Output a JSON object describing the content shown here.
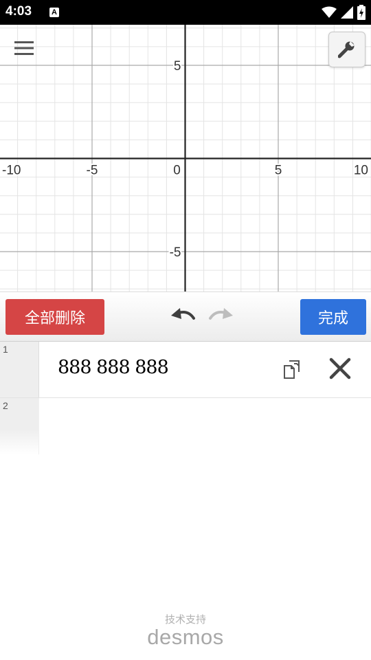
{
  "status_bar": {
    "time": "4:03",
    "notification_icon": "A"
  },
  "graph": {
    "x_range": [
      -10,
      10
    ],
    "y_range": [
      -7,
      7
    ],
    "grid": true,
    "x_tick_labels": [
      "-10",
      "-5",
      "0",
      "5",
      "10"
    ],
    "y_tick_labels": [
      "5",
      "-5"
    ]
  },
  "graph_controls": {
    "menu_icon": "hamburger-menu-icon",
    "settings_icon": "wrench-icon"
  },
  "toolbar": {
    "delete_all_label": "全部删除",
    "undo_icon": "undo-icon",
    "redo_icon": "redo-icon",
    "done_label": "完成"
  },
  "expressions": [
    {
      "index": "1",
      "text": "888 888 888"
    },
    {
      "index": "2",
      "text": ""
    }
  ],
  "footer": {
    "powered_by": "技术支持",
    "logo_text": "desmos"
  },
  "colors": {
    "delete_all_bg": "#d54545",
    "done_bg": "#2f72dc",
    "axis": "#222222",
    "major_grid": "#a9a9a9",
    "minor_grid": "#e4e4e4"
  }
}
